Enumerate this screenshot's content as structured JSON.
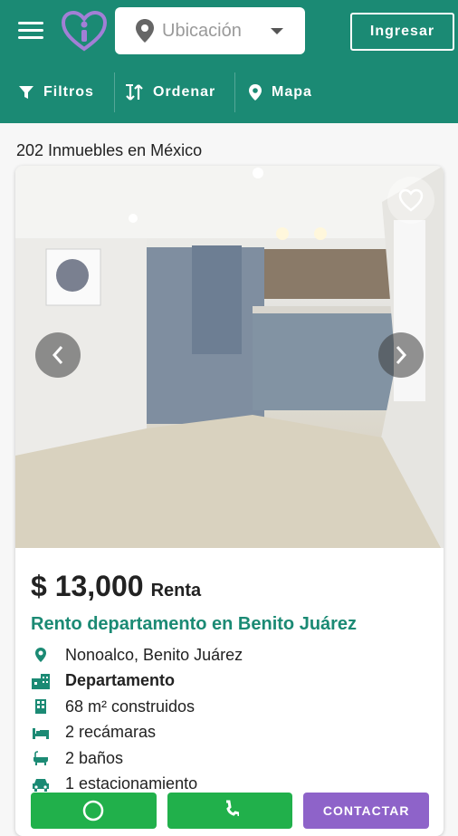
{
  "header": {
    "location_placeholder": "Ubicación",
    "login_label": "Ingresar",
    "toolbar": {
      "filters": "Filtros",
      "sort": "Ordenar",
      "map": "Mapa"
    }
  },
  "results": {
    "count_text": "202 Inmuebles en México"
  },
  "listing": {
    "price": "$ 13,000",
    "operation": "Renta",
    "title": "Rento departamento en Benito Juárez",
    "details": {
      "location": "Nonoalco, Benito Juárez",
      "type": "Departamento",
      "area": "68 m² construidos",
      "bedrooms": "2 recámaras",
      "bathrooms": "2 baños",
      "parking": "1 estacionamiento"
    },
    "contact_label": "CONTACTAR"
  },
  "colors": {
    "brand": "#1b8a74",
    "whatsapp": "#21b04b",
    "contact": "#8e63c9"
  }
}
